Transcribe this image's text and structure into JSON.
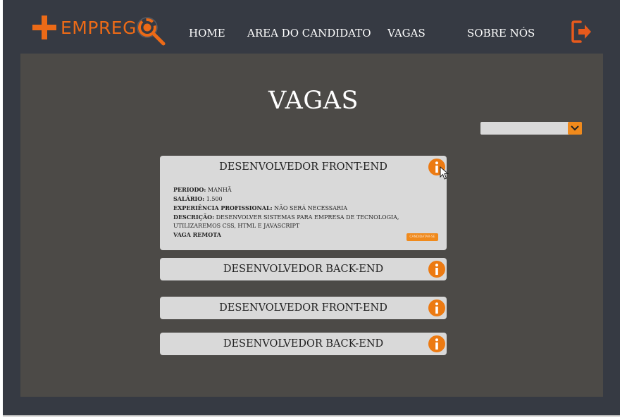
{
  "header": {
    "brand_text": "EMPREG",
    "nav": [
      "HOME",
      "AREA DO CANDIDATO",
      "VAGAS",
      "SOBRE NÓS"
    ],
    "icons": {
      "logo": "plus-icon",
      "magnifier": "magnifier-icon",
      "logout": "logout-icon"
    }
  },
  "main": {
    "title": "VAGAS",
    "filter": {
      "selected": ""
    },
    "jobs": [
      {
        "title": "DESENVOLVEDOR FRONT-END",
        "expanded": true,
        "details": {
          "periodo_label": "PERIODO:",
          "periodo": "MANHÃ",
          "salario_label": "SALÁRIO:",
          "salario": "1.500",
          "experiencia_label": "EXPERIÊNCIA PROFISSIONAL:",
          "experiencia": "NÃO SERÁ NECESSARIA",
          "descricao_label": "DESCRIÇÃO:",
          "descricao": "DESENVOLVER SISTEMAS PARA EMPRESA DE TECNOLOGIA, UTILIZAREMOS CSS, HTML E JAVASCRIPT",
          "remote": "VAGA REMOTA"
        },
        "apply_label": "CANDIDATAR-SE"
      },
      {
        "title": "DESENVOLVEDOR BACK-END",
        "expanded": false
      },
      {
        "title": "DESENVOLVEDOR FRONT-END",
        "expanded": false
      },
      {
        "title": "DESENVOLVEDOR BACK-END",
        "expanded": false
      }
    ]
  },
  "colors": {
    "frame": "#363a43",
    "panel": "#4c4a47",
    "card": "#d9d9d9",
    "accent": "#ec6a17"
  }
}
